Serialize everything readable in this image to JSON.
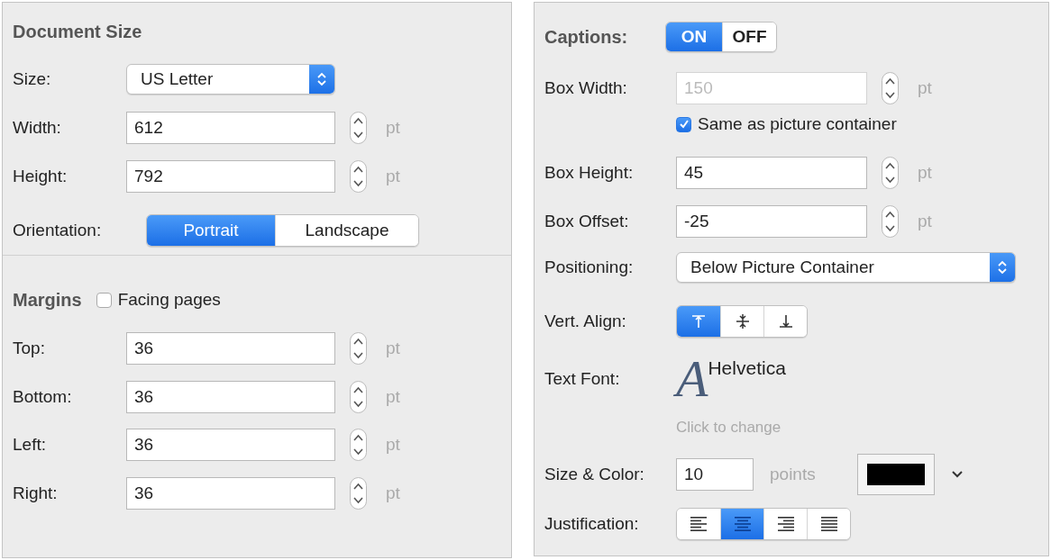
{
  "document_size": {
    "title": "Document Size",
    "size": {
      "label": "Size:",
      "value": "US Letter"
    },
    "fields": [
      {
        "label": "Width:",
        "value": "612",
        "unit": "pt"
      },
      {
        "label": "Height:",
        "value": "792",
        "unit": "pt"
      }
    ],
    "orientation": {
      "label": "Orientation:",
      "options": [
        {
          "label": "Portrait",
          "selected": true
        },
        {
          "label": "Landscape",
          "selected": false
        }
      ]
    }
  },
  "margins": {
    "title": "Margins",
    "facing_pages": {
      "label": "Facing pages",
      "checked": false
    },
    "fields": [
      {
        "label": "Top:",
        "value": "36",
        "unit": "pt"
      },
      {
        "label": "Bottom:",
        "value": "36",
        "unit": "pt"
      },
      {
        "label": "Left:",
        "value": "36",
        "unit": "pt"
      },
      {
        "label": "Right:",
        "value": "36",
        "unit": "pt"
      }
    ]
  },
  "captions": {
    "label": "Captions:",
    "toggle": [
      {
        "label": "ON",
        "selected": true
      },
      {
        "label": "OFF",
        "selected": false
      }
    ],
    "box_width": {
      "label": "Box Width:",
      "value": "150",
      "unit": "pt",
      "disabled": true
    },
    "same_as_container": {
      "label": "Same as picture container",
      "checked": true
    },
    "fields": [
      {
        "label": "Box Height:",
        "value": "45",
        "unit": "pt",
        "disabled": false
      },
      {
        "label": "Box Offset:",
        "value": "-25",
        "unit": "pt",
        "disabled": false
      }
    ],
    "positioning": {
      "label": "Positioning:",
      "value": "Below Picture Container"
    },
    "vert_align": {
      "label": "Vert. Align:",
      "options": [
        {
          "kind": "top",
          "selected": true
        },
        {
          "kind": "middle",
          "selected": false
        },
        {
          "kind": "bottom",
          "selected": false
        }
      ]
    },
    "text_font": {
      "label": "Text Font:",
      "icon_glyph": "A",
      "font_name": "Helvetica",
      "hint": "Click to change"
    },
    "size_color": {
      "label": "Size & Color:",
      "value": "10",
      "unit": "points",
      "color": "#000000"
    },
    "justification": {
      "label": "Justification:",
      "options": [
        {
          "kind": "left",
          "selected": false
        },
        {
          "kind": "center",
          "selected": true
        },
        {
          "kind": "right",
          "selected": false
        },
        {
          "kind": "justify",
          "selected": false
        }
      ]
    }
  }
}
